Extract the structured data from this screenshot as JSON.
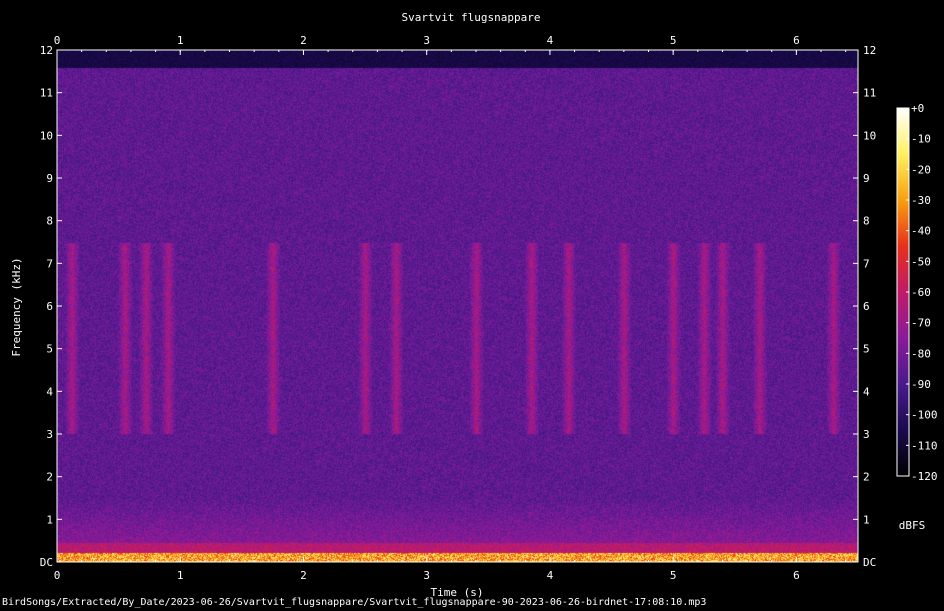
{
  "chart_data": {
    "type": "heatmap",
    "title": "Svartvit flugsnappare",
    "xlabel": "Time (s)",
    "ylabel": "Frequency (kHz)",
    "xlim": [
      0,
      6.5
    ],
    "ylim": [
      0,
      12
    ],
    "x_ticks": [
      "0",
      "1",
      "2",
      "3",
      "4",
      "5",
      "6"
    ],
    "y_ticks": [
      "DC",
      "1",
      "2",
      "3",
      "4",
      "5",
      "6",
      "7",
      "8",
      "9",
      "10",
      "11",
      "12"
    ],
    "colorbar": {
      "label": "dBFS",
      "ticks": [
        "+0",
        "-10",
        "-20",
        "-30",
        "-40",
        "-50",
        "-60",
        "-70",
        "-80",
        "-90",
        "-100",
        "-110",
        "-120"
      ],
      "range": [
        -120,
        0
      ],
      "colormap": [
        "#000000",
        "#1a0a4e",
        "#4a1a8c",
        "#8a1a9a",
        "#c01a6a",
        "#e8301a",
        "#f8a010",
        "#fff060",
        "#ffffff"
      ]
    },
    "signal_top_khz": 11.6,
    "call_times_s": [
      0.12,
      0.55,
      0.72,
      0.9,
      1.75,
      2.5,
      2.75,
      3.4,
      3.85,
      4.15,
      4.6,
      5.0,
      5.25,
      5.4,
      5.7,
      6.3
    ]
  },
  "footer": {
    "path": "BirdSongs/Extracted/By_Date/2023-06-26/Svartvit_flugsnappare/Svartvit_flugsnappare-90-2023-06-26-birdnet-17:08:10.mp3"
  },
  "colors": {
    "background": "#000000",
    "text": "#ffffff"
  }
}
